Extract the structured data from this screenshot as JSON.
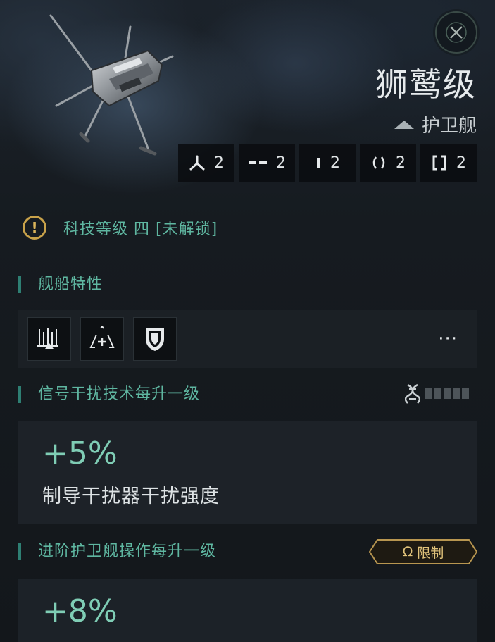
{
  "header": {
    "ship_name": "狮鹫级",
    "ship_class": "护卫舰",
    "close_icon": "close-x-icon"
  },
  "slots": [
    {
      "icon": "tri-branch-icon",
      "value": "2"
    },
    {
      "icon": "dash-icon",
      "value": "2"
    },
    {
      "icon": "bar-icon",
      "value": "2"
    },
    {
      "icon": "parens-icon",
      "value": "2"
    },
    {
      "icon": "brackets-icon",
      "value": "2"
    }
  ],
  "tech": {
    "text": "科技等级 四 [未解锁]",
    "icon": "warning-icon"
  },
  "traits": {
    "title": "舰船特性",
    "icons": [
      "missile-rack-icon",
      "triangle-plus-icon",
      "shield-icon"
    ],
    "more": "···"
  },
  "skill1": {
    "title": "信号干扰技术每升一级",
    "value": "+5%",
    "description": "制导干扰器干扰强度",
    "levels_trained": 0,
    "levels_total": 5
  },
  "skill2": {
    "title": "进阶护卫舰操作每升一级",
    "badge": "限制",
    "badge_symbol": "Ω",
    "value": "+8%"
  },
  "colors": {
    "accent": "#5fb7a1",
    "warning": "#c8a24a",
    "badge": "#e0c27a"
  }
}
